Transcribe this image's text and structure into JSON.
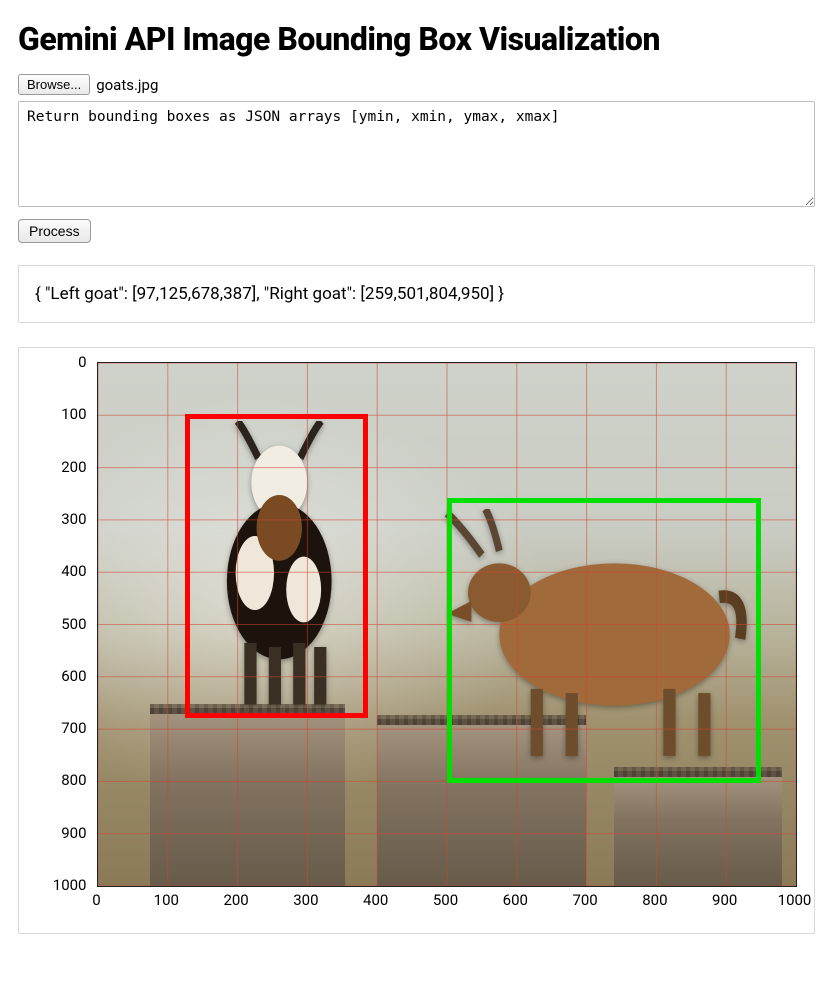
{
  "header": {
    "title": "Gemini API Image Bounding Box Visualization"
  },
  "file_input": {
    "button_label": "Browse...",
    "filename": "goats.jpg"
  },
  "prompt": {
    "value": "Return bounding boxes as JSON arrays [ymin, xmin, ymax, xmax]"
  },
  "process": {
    "label": "Process"
  },
  "output": {
    "text": "{ \"Left goat\": [97,125,678,387], \"Right goat\": [259,501,804,950] }"
  },
  "chart_data": {
    "type": "scatter",
    "title": "",
    "xlabel": "",
    "ylabel": "",
    "xlim": [
      0,
      1000
    ],
    "ylim": [
      0,
      1000
    ],
    "x_ticks": [
      0,
      100,
      200,
      300,
      400,
      500,
      600,
      700,
      800,
      900,
      1000
    ],
    "y_ticks": [
      0,
      100,
      200,
      300,
      400,
      500,
      600,
      700,
      800,
      900,
      1000
    ],
    "y_inverted": true,
    "grid": true,
    "grid_color": "#d24632",
    "boxes": [
      {
        "label": "Left goat",
        "coords_ymin_xmin_ymax_xmax": [
          97,
          125,
          678,
          387
        ],
        "color": "#ff0000"
      },
      {
        "label": "Right goat",
        "coords_ymin_xmin_ymax_xmax": [
          259,
          501,
          804,
          950
        ],
        "color": "#00e000"
      }
    ]
  }
}
